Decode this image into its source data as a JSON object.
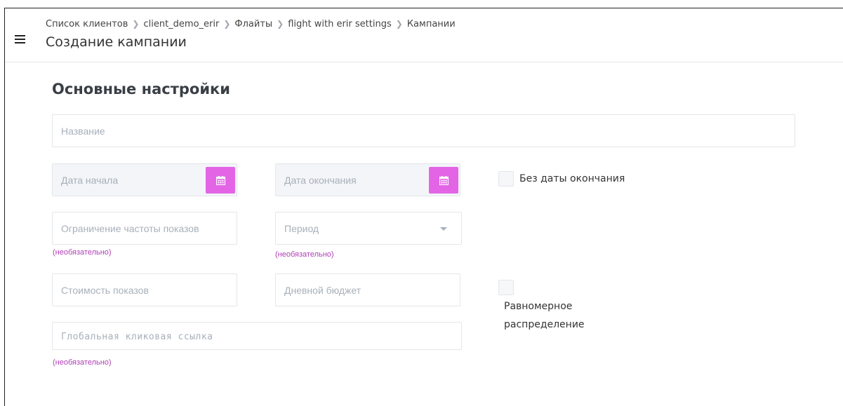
{
  "breadcrumb": [
    "Список клиентов",
    "client_demo_erir",
    "Флайты",
    "flight with erir settings",
    "Кампании"
  ],
  "page_title": "Создание кампании",
  "section_title": "Основные настройки",
  "form": {
    "name_placeholder": "Название",
    "start_date_placeholder": "Дата начала",
    "end_date_placeholder": "Дата окончания",
    "no_end_date_label": "Без даты окончания",
    "frequency_cap_placeholder": "Ограничение частоты показов",
    "frequency_cap_hint": "(необязательно)",
    "period_placeholder": "Период",
    "period_hint": "(необязательно)",
    "cost_placeholder": "Стоимость показов",
    "daily_budget_placeholder": "Дневной бюджет",
    "even_distribution_label_1": "Равномерное",
    "even_distribution_label_2": "распределение",
    "global_link_placeholder": "Глобальная кликовая ссылка",
    "global_link_hint": "(необязательно)"
  },
  "colors": {
    "accent": "#e365e6",
    "hint": "#b03fb5"
  }
}
